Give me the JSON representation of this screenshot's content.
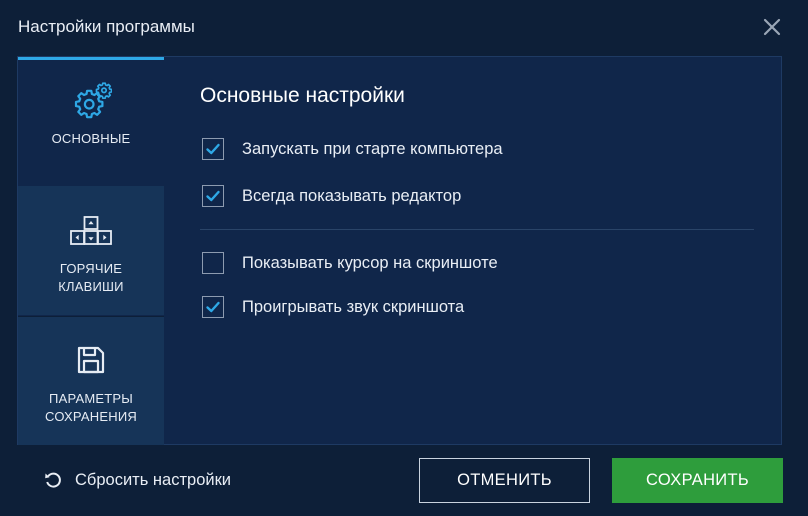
{
  "window": {
    "title": "Настройки программы"
  },
  "sidebar": {
    "items": [
      {
        "label": "ОСНОВНЫЕ",
        "icon": "gears-icon",
        "active": true
      },
      {
        "label_line1": "ГОРЯЧИЕ",
        "label_line2": "КЛАВИШИ",
        "icon": "keys-icon",
        "active": false
      },
      {
        "label_line1": "ПАРАМЕТРЫ",
        "label_line2": "СОХРАНЕНИЯ",
        "icon": "floppy-icon",
        "active": false
      }
    ]
  },
  "main": {
    "title": "Основные настройки",
    "options": [
      {
        "label": "Запускать при старте компьютера",
        "checked": true
      },
      {
        "label": "Всегда показывать редактор",
        "checked": true
      },
      {
        "label": "Показывать курсор на скриншоте",
        "checked": false
      },
      {
        "label": "Проигрывать звук скриншота",
        "checked": true
      }
    ]
  },
  "footer": {
    "reset_label": "Сбросить настройки",
    "cancel_label": "ОТМЕНИТЬ",
    "save_label": "СОХРАНИТЬ"
  },
  "colors": {
    "background": "#0d1f38",
    "panel": "#10264a",
    "accent": "#2ea8e6",
    "save_button": "#2e9d3c"
  }
}
